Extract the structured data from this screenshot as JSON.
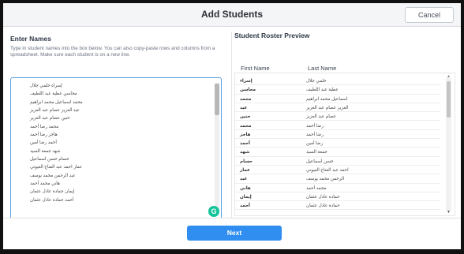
{
  "dialog": {
    "title": "Add Students",
    "cancel_label": "Cancel",
    "next_label": "Next"
  },
  "enter_names": {
    "title": "Enter Names",
    "instructions": "Type in student names into the box below. You can also copy-paste rows and columns from a spreadsheet. Make sure each student is on a new line.",
    "lines": [
      "إسراء حلمي جلال",
      "محاسن عطية عبد اللطيف",
      "محمد اسماعيل محمد ابراهيم",
      "عيد العزيز عصام عبد العزيز",
      "حنين عصام عبد العزيز",
      "محمد رضا أحمد",
      "هاجر رضا أحمد",
      "أحمد رضا أمين",
      "شهد جمعة السيد",
      "حسام حسن اسماعيل",
      "عمار احمد عبد الفتاح العيوني",
      "عبد الرحمن محمد يوسف",
      "هاني محمد أحمد",
      "إيمان حمادة عادل عثمان",
      "أحمد حمادة عادل عثمان"
    ]
  },
  "preview": {
    "title": "Student Roster Preview",
    "first_name_header": "First Name",
    "last_name_header": "Last Name",
    "rows": [
      {
        "first": "إسراء",
        "last": "حلمي جلال"
      },
      {
        "first": "محاسن",
        "last": "عطية عبد اللطيف"
      },
      {
        "first": "محمد",
        "last": "اسماعيل محمد ابراهيم"
      },
      {
        "first": "عيد",
        "last": "العزيز عصام عبد العزيز"
      },
      {
        "first": "حنين",
        "last": "عصام عبد العزيز"
      },
      {
        "first": "محمد",
        "last": "رضا أحمد"
      },
      {
        "first": "هاجر",
        "last": "رضا أحمد"
      },
      {
        "first": "أحمد",
        "last": "رضا أمين"
      },
      {
        "first": "شهد",
        "last": "جمعة السيد"
      },
      {
        "first": "حسام",
        "last": "حسن اسماعيل"
      },
      {
        "first": "عمار",
        "last": "احمد عبد الفتاح العيوني"
      },
      {
        "first": "عبد",
        "last": "الرحمن محمد يوسف"
      },
      {
        "first": "هاني",
        "last": "محمد أحمد"
      },
      {
        "first": "إيمان",
        "last": "حمادة عادل عثمان"
      },
      {
        "first": "أحمد",
        "last": "حمادة عادل عثمان"
      }
    ]
  },
  "icons": {
    "grammar_icon_letter": "G"
  },
  "colors": {
    "accent": "#2f8ef0",
    "textarea_focus": "#5aa0e6",
    "grammar_icon": "#15c39a"
  }
}
